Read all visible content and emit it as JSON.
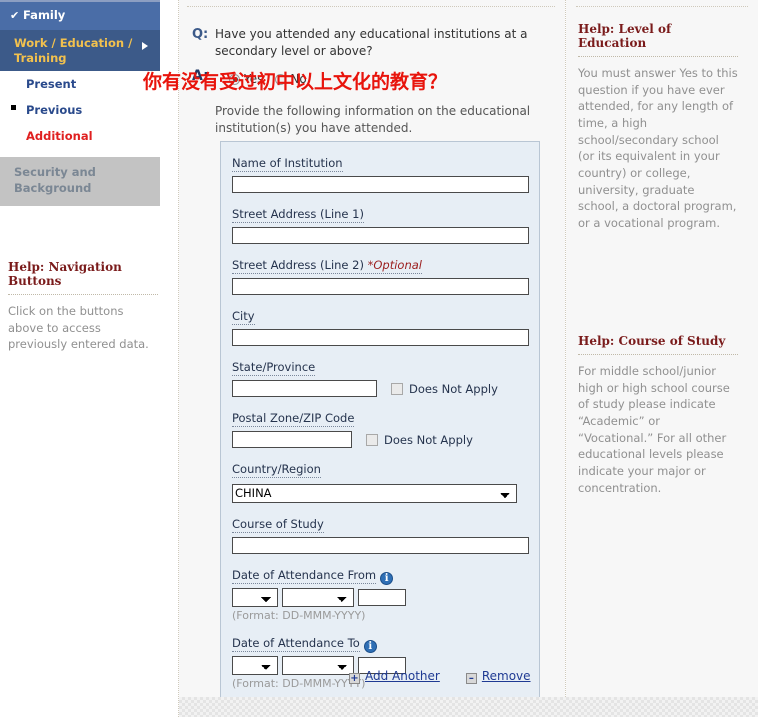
{
  "sidebar": {
    "completed": {
      "label": "Family",
      "check_glyph": "✔"
    },
    "current": {
      "label": "Work / Education / Training"
    },
    "sub_items": [
      {
        "label": "Present",
        "state": "normal"
      },
      {
        "label": "Previous",
        "state": "active"
      },
      {
        "label": "Additional",
        "state": "alert"
      }
    ],
    "disabled_section": {
      "label": "Security and Background"
    },
    "help": {
      "title": "Help: Navigation Buttons",
      "body": "Click on the buttons above to access previously entered data."
    }
  },
  "main": {
    "q_label": "Q:",
    "a_label": "A:",
    "question": "Have you attended any educational institutions at a secondary level or above?",
    "answer": {
      "yes_label": "Yes",
      "no_label": "No",
      "selected": "Yes"
    },
    "annotation_cn": "你有没有受过初中以上文化的教育？",
    "instruction": "Provide the following information on the educational institution(s) you have attended.",
    "form": {
      "name_of_institution": {
        "label": "Name of Institution",
        "value": ""
      },
      "street_line_1": {
        "label": "Street Address (Line 1)",
        "value": ""
      },
      "street_line_2": {
        "label": "Street Address (Line 2)",
        "optional": "*Optional",
        "value": ""
      },
      "city": {
        "label": "City",
        "value": ""
      },
      "state_province": {
        "label": "State/Province",
        "value": "",
        "does_not_apply_label": "Does Not Apply",
        "does_not_apply_checked": false
      },
      "postal_code": {
        "label": "Postal Zone/ZIP Code",
        "value": "",
        "does_not_apply_label": "Does Not Apply",
        "does_not_apply_checked": false
      },
      "country_region": {
        "label": "Country/Region",
        "selected": "CHINA"
      },
      "course_of_study": {
        "label": "Course of Study",
        "value": ""
      },
      "date_from": {
        "label": "Date of Attendance From",
        "day": "",
        "month": "",
        "year": "",
        "format_hint": "(Format: DD-MMM-YYYY)",
        "info_glyph": "i"
      },
      "date_to": {
        "label": "Date of Attendance To",
        "day": "",
        "month": "",
        "year": "",
        "format_hint": "(Format: DD-MMM-YYYY)",
        "info_glyph": "i"
      }
    },
    "actions": {
      "add_another": {
        "label": "Add Another",
        "icon": "+"
      },
      "remove": {
        "label": "Remove",
        "icon": "–"
      }
    }
  },
  "help_panels": [
    {
      "title": "Help: Level of Education",
      "body": "You must answer Yes to this question if you have ever attended, for any length of time, a high school/secondary school (or its equivalent in your country) or college, university, graduate school, a doctoral program, or a vocational program."
    },
    {
      "title": "Help: Course of Study",
      "body": "For middle school/junior high or high school course of study please indicate “Academic” or “Vocational.” For all other educational levels please indicate your major or concentration."
    }
  ],
  "colors": {
    "nav_done_bg": "#4a6da7",
    "nav_current_bg": "#3c5a89",
    "nav_current_text": "#f2c14e",
    "panel_bg": "#e7eef5",
    "annotation_red": "#e8140c",
    "help_title": "#7a1b1b",
    "alert_link": "#e02020"
  }
}
